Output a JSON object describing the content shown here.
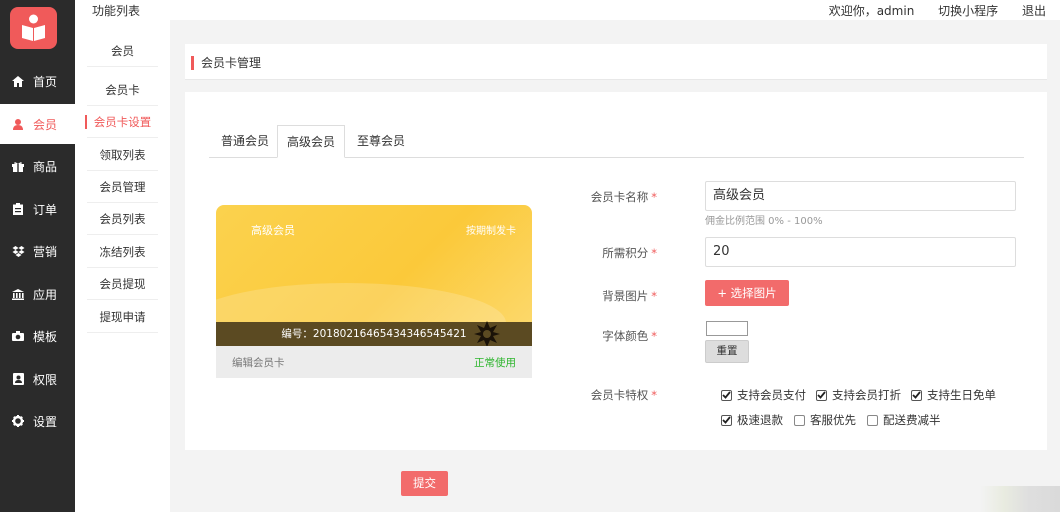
{
  "nav": {
    "items": [
      {
        "label": "首页",
        "icon": "home-icon"
      },
      {
        "label": "会员",
        "icon": "user-icon"
      },
      {
        "label": "商品",
        "icon": "gift-icon"
      },
      {
        "label": "订单",
        "icon": "clipboard-icon"
      },
      {
        "label": "营销",
        "icon": "dropbox-icon"
      },
      {
        "label": "应用",
        "icon": "bank-icon"
      },
      {
        "label": "模板",
        "icon": "camera-icon"
      },
      {
        "label": "权限",
        "icon": "id-card-icon"
      },
      {
        "label": "设置",
        "icon": "gear-icon"
      }
    ]
  },
  "topbar": {
    "title": "功能列表",
    "welcome": "欢迎你，admin",
    "switch": "切换小程序",
    "logout": "退出"
  },
  "subnav": {
    "section": "会员",
    "items": [
      "会员卡",
      "会员卡设置",
      "领取列表",
      "会员管理",
      "会员列表",
      "冻结列表",
      "会员提现",
      "提现申请"
    ]
  },
  "panel": {
    "title": "会员卡管理"
  },
  "tabs": [
    "普通会员",
    "高级会员",
    "至尊会员"
  ],
  "card": {
    "name": "高级会员",
    "type": "按期制发卡",
    "number": "编号：20180216465434346545421",
    "edit": "编辑会员卡",
    "status": "正常使用",
    "colors": {
      "primary": "#fbc93a",
      "band": "#5b4a22",
      "status": "#2db52d"
    }
  },
  "form": {
    "name_label": "会员卡名称",
    "name_value": "高级会员",
    "name_hint": "佣金比例范围 0% - 100%",
    "points_label": "所需积分",
    "points_value": "20",
    "bg_label": "背景图片",
    "bg_button": "选择图片",
    "font_label": "字体颜色",
    "reset_button": "重置",
    "privilege_label": "会员卡特权",
    "privileges": [
      {
        "label": "支持会员支付",
        "checked": true
      },
      {
        "label": "支持会员打折",
        "checked": true
      },
      {
        "label": "支持生日免单",
        "checked": true
      },
      {
        "label": "极速退款",
        "checked": true
      },
      {
        "label": "客服优先",
        "checked": false
      },
      {
        "label": "配送费减半",
        "checked": false
      }
    ]
  },
  "submit": "提交",
  "accent": "#f05a5a"
}
